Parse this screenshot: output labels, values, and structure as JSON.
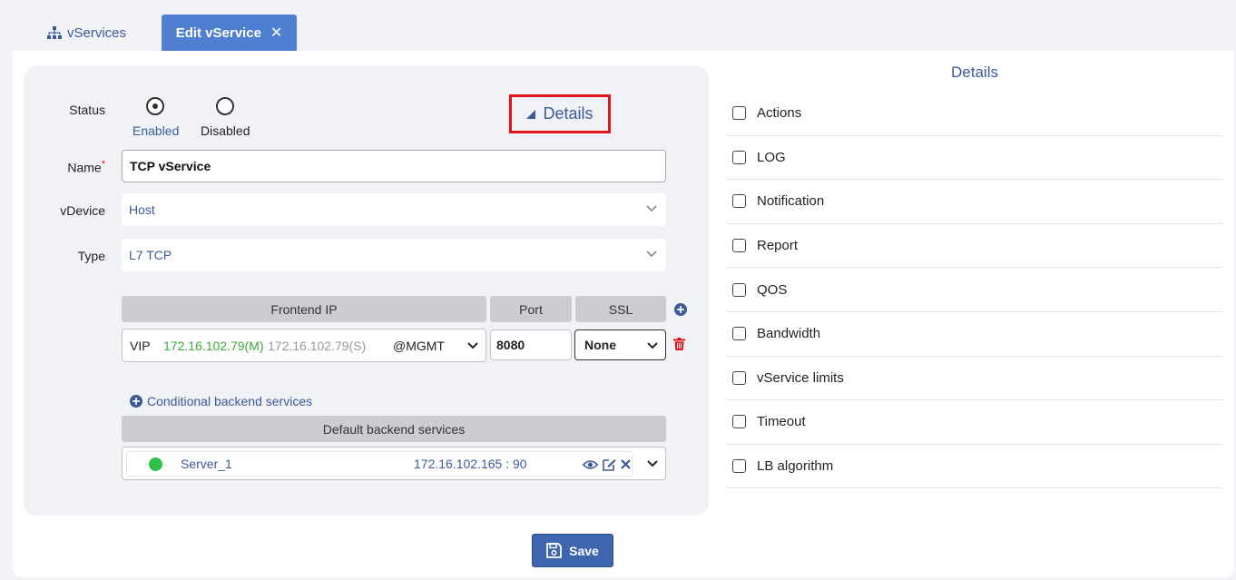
{
  "tabs": {
    "vservices_label": "vServices",
    "edit_label": "Edit vService",
    "close_glyph": "✕"
  },
  "form": {
    "status_label": "Status",
    "status_enabled": "Enabled",
    "status_disabled": "Disabled",
    "status_selected": "Enabled",
    "name_label": "Name",
    "required_mark": "*",
    "name_value": "TCP vService",
    "vdevice_label": "vDevice",
    "vdevice_value": "Host",
    "type_label": "Type",
    "type_value": "L7 TCP",
    "details_toggle": "Details"
  },
  "frontend": {
    "header_ip": "Frontend IP",
    "header_port": "Port",
    "header_ssl": "SSL",
    "vip_label": "VIP",
    "ip_master": "172.16.102.79(M)",
    "ip_slave": "172.16.102.79(S)",
    "interface": "@MGMT",
    "port": "8080",
    "ssl": "None"
  },
  "backend": {
    "conditional_link": "Conditional backend services",
    "default_header": "Default backend services",
    "servers": [
      {
        "name": "Server_1",
        "address": "172.16.102.165 : 90",
        "status_color": "#2fbf4a"
      }
    ]
  },
  "save_label": "Save",
  "details_panel": {
    "title": "Details",
    "items": [
      "Actions",
      "LOG",
      "Notification",
      "Report",
      "QOS",
      "Bandwidth",
      "vService limits",
      "Timeout",
      "LB algorithm"
    ]
  },
  "colors": {
    "accent": "#3b5a9a",
    "tab_active": "#4f7fd1",
    "ip_master": "#3aa83a",
    "ip_slave": "#9a9a9a",
    "danger": "#e0141b",
    "highlight_box": "#e0141b"
  },
  "icons": {
    "sitemap": "sitemap-icon",
    "add": "plus-circle-icon",
    "trash": "trash-icon",
    "eye": "eye-icon",
    "edit": "edit-icon",
    "remove": "close-icon",
    "save": "floppy-disk-icon",
    "caret": "caret-icon",
    "chevron": "chevron-down-icon"
  }
}
